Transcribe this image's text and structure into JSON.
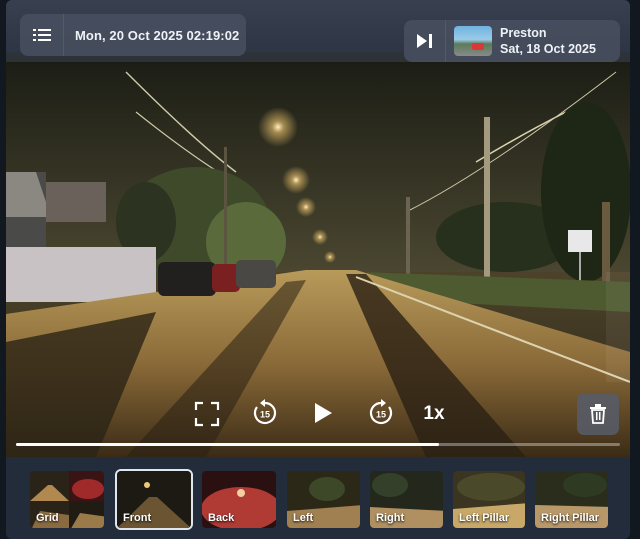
{
  "header": {
    "current_datetime": "Mon, 20 Oct 2025 02:19:02",
    "next_clip": {
      "location": "Preston",
      "date": "Sat, 18 Oct 2025"
    }
  },
  "icons": {
    "menu": "list-menu-icon",
    "skip": "skip-forward-icon",
    "fullscreen": "fullscreen-icon",
    "rewind": "rewind-15-icon",
    "play": "play-icon",
    "forward": "forward-15-icon",
    "delete": "trash-icon"
  },
  "controls": {
    "rewind_seconds": "15",
    "forward_seconds": "15",
    "speed_label": "1x"
  },
  "playback": {
    "progress_fraction": 0.7
  },
  "cameras": [
    {
      "label": "Grid",
      "active": false
    },
    {
      "label": "Front",
      "active": true
    },
    {
      "label": "Back",
      "active": false
    },
    {
      "label": "Left",
      "active": false
    },
    {
      "label": "Right",
      "active": false
    },
    {
      "label": "Left Pillar",
      "active": false
    },
    {
      "label": "Right Pillar",
      "active": false
    }
  ],
  "colors": {
    "accent": "#ffffff",
    "panel": "#465e6e",
    "active_border": "#dfe6ee"
  }
}
